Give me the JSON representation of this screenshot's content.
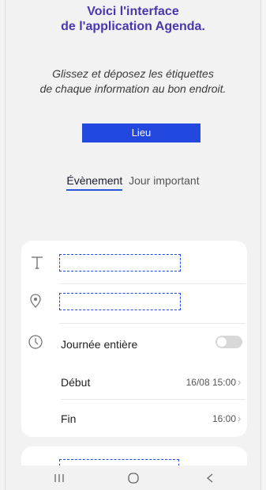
{
  "header": {
    "title_line1": "Voici l'interface",
    "title_line2": "de l'application Agenda.",
    "instruction_line1": "Glissez et déposez les étiquettes",
    "instruction_line2": "de chaque information au bon endroit."
  },
  "drag_tag": {
    "label": "Lieu"
  },
  "tabs": [
    {
      "label": "Évènement",
      "active": true
    },
    {
      "label": "Jour important",
      "active": false
    }
  ],
  "event_form": {
    "title_icon": "text-t-icon",
    "location_icon": "location-pin-icon",
    "clock_icon": "clock-icon",
    "all_day": {
      "label": "Journée entière",
      "toggle_on": false
    },
    "start": {
      "label": "Début",
      "value": "16/08 15:00"
    },
    "end": {
      "label": "Fin",
      "value": "16:00"
    }
  },
  "nav": {
    "recents_icon": "recent-apps-icon",
    "home_icon": "home-icon",
    "back_icon": "back-icon"
  },
  "colors": {
    "title": "#4b36b0",
    "tag_background": "#2348e0",
    "drop_zone_border": "#2348e0",
    "active_tab_underline": "#2a57d8"
  }
}
